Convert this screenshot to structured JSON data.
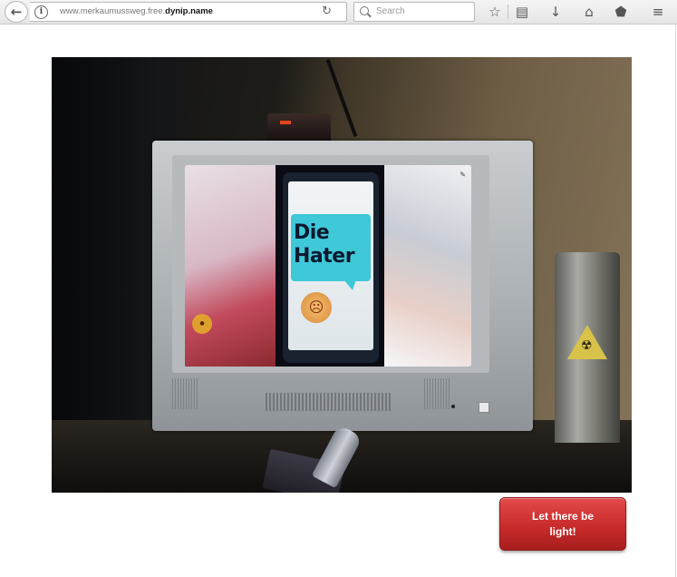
{
  "browser": {
    "url_prefix": "www.merkaumussweg.free.",
    "url_domain": "dynip.name",
    "search_placeholder": "Search",
    "icons": [
      "back-arrow-icon",
      "info-icon",
      "reload-icon",
      "search-icon",
      "bookmark-star-icon",
      "reading-list-icon",
      "download-icon",
      "home-icon",
      "pocket-icon",
      "menu-icon"
    ]
  },
  "webcam": {
    "screen_headline_line1": "Die",
    "screen_headline_line2": "Hater"
  },
  "action": {
    "button_label": "Let there be light!",
    "button_color": "#c92b2b"
  }
}
